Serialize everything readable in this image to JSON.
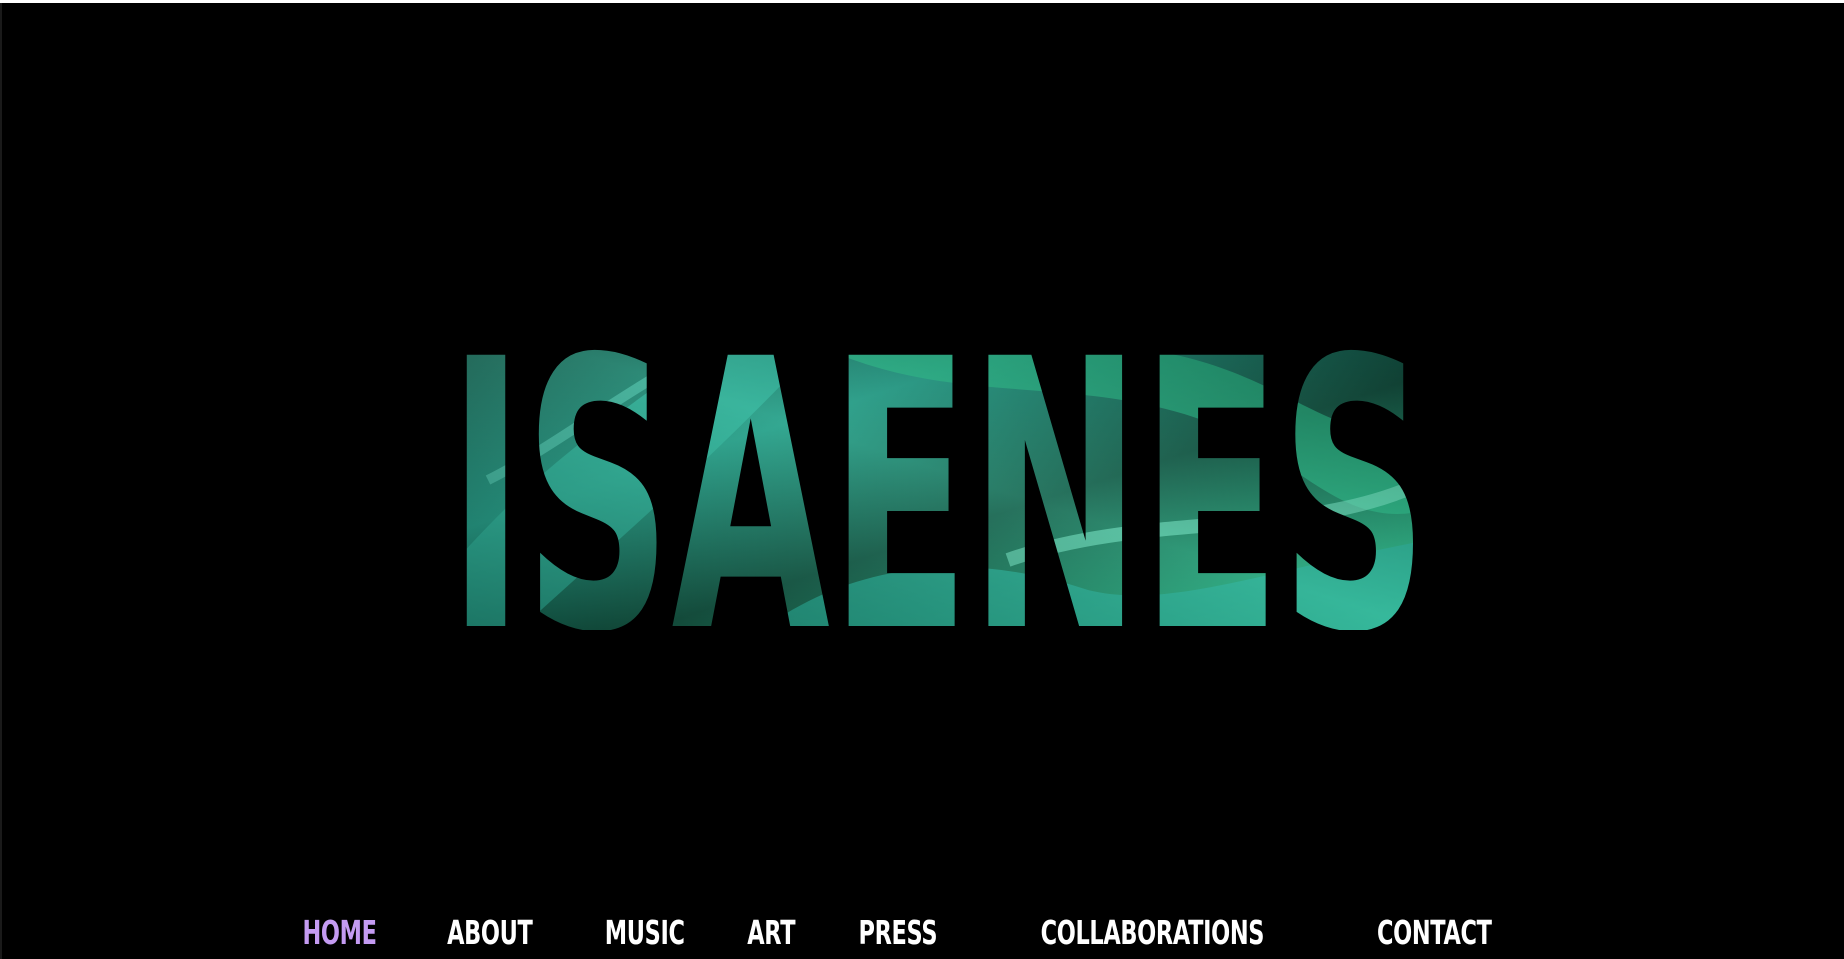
{
  "hero": {
    "logo_text": "ISAENES",
    "colors": {
      "deep": "#041c18",
      "teal": "#1d8a7a",
      "green": "#27c98a",
      "light": "#5fe2c0"
    }
  },
  "nav": {
    "active_color": "#c49bf2",
    "items": [
      {
        "label": "HOME",
        "active": true
      },
      {
        "label": "ABOUT",
        "active": false
      },
      {
        "label": "MUSIC",
        "active": false
      },
      {
        "label": "ART",
        "active": false
      },
      {
        "label": "PRESS",
        "active": false
      },
      {
        "label": "COLLABORATIONS",
        "active": false
      },
      {
        "label": "CONTACT",
        "active": false
      }
    ]
  }
}
